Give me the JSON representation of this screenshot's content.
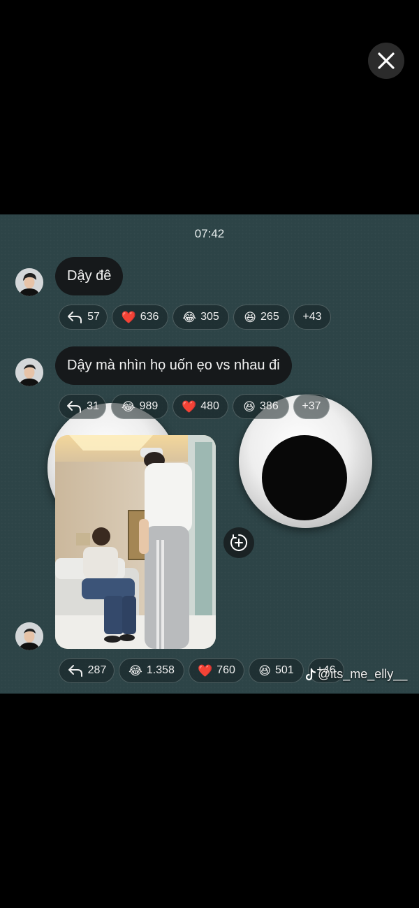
{
  "time": "07:42",
  "messages": [
    {
      "text": "Dậy đê",
      "reactions": [
        {
          "icon": "reply-arrow",
          "count": "57"
        },
        {
          "icon": "heart",
          "emoji": "❤️",
          "count": "636"
        },
        {
          "icon": "tears-of-joy",
          "emoji": "😂",
          "count": "305"
        },
        {
          "icon": "laughing-face",
          "emoji": "😆",
          "count": "265"
        },
        {
          "count": "+43"
        }
      ]
    },
    {
      "text": "Dậy mà nhìn họ uốn ẹo vs nhau đi",
      "reactions": [
        {
          "icon": "reply-arrow",
          "count": "31"
        },
        {
          "icon": "tears-of-joy",
          "emoji": "😂",
          "count": "989"
        },
        {
          "icon": "heart",
          "emoji": "❤️",
          "count": "480"
        },
        {
          "icon": "laughing-face",
          "emoji": "😆",
          "count": "386"
        },
        {
          "count": "+37"
        }
      ]
    },
    {
      "type": "photo",
      "reactions": [
        {
          "icon": "reply-arrow",
          "count": "287"
        },
        {
          "icon": "tears-of-joy",
          "emoji": "😂",
          "count": "1.358"
        },
        {
          "icon": "heart",
          "emoji": "❤️",
          "count": "760"
        },
        {
          "icon": "laughing-face",
          "emoji": "😆",
          "count": "501"
        },
        {
          "count": "+46"
        }
      ]
    }
  ],
  "watermark": {
    "icon": "tiktok-logo",
    "handle": "@its_me_elly__"
  },
  "colors": {
    "background": "#000000",
    "chat_bg": "#2d4447",
    "bubble": "#16191b"
  }
}
